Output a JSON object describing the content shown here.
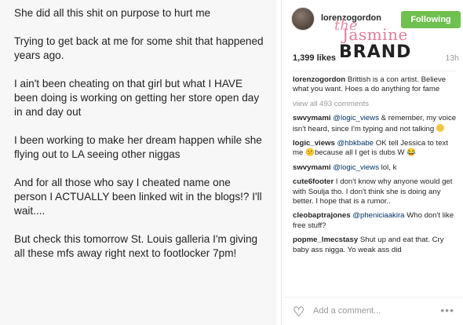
{
  "notes": {
    "paragraphs": [
      "She did all this shit on purpose to hurt me",
      "Trying to get back at me for some shit that happened years ago.",
      "I ain't been cheating on that girl but what I HAVE been doing is working on getting her store open day in and day out",
      "I been working to make her dream happen while she flying out to LA seeing other niggas",
      "And for all those who say I cheated name one person I ACTUALLY been linked wit in the blogs!? I'll wait....",
      "But check this tomorrow St. Louis galleria I'm giving all these mfs away right next to footlocker 7pm!"
    ]
  },
  "instagram": {
    "username": "lorenzogordon",
    "follow_label": "Following",
    "watermark": {
      "the": "the",
      "jasmine": "Jasmine",
      "brand": "BRAND"
    },
    "likes": "1,399 likes",
    "time": "13h",
    "caption": {
      "user": "lorenzogordon",
      "text": "Brittish is a con artist. Believe what you want. Hoes a do anything for fame"
    },
    "view_all": "view all 493 comments",
    "comments": [
      {
        "user": "swvymami",
        "mention": "@logic_views",
        "text": "& remember, my voice isn't heard, since I'm typing and not talking"
      },
      {
        "user": "logic_views",
        "mention": "@hbkbabe",
        "text": "OK tell Jessica to text me 😕because all I get is dubs W 😂"
      },
      {
        "user": "swvymami",
        "mention": "@logic_views",
        "text": "lol, k"
      },
      {
        "user": "cute6footer",
        "mention": "",
        "text": "I don't know why anyone would get with Soulja tho. I don't think she is doing any better. I hope that is a rumor.."
      },
      {
        "user": "cleobaptrajones",
        "mention": "@pheniciaakira",
        "text": "Who don't like free stuff?"
      },
      {
        "user": "popme_lmecstasy",
        "mention": "",
        "text": "Shut up and eat that. Cry baby ass nigga. Yo weak ass did"
      }
    ],
    "add_comment_placeholder": "Add a comment..."
  }
}
